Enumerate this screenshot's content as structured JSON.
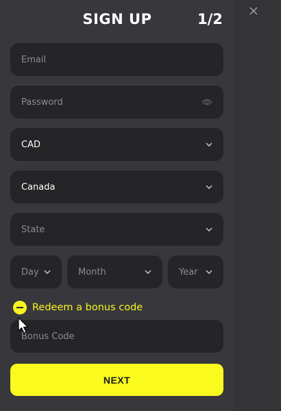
{
  "header": {
    "title": "SIGN UP",
    "step": "1/2"
  },
  "form": {
    "email_placeholder": "Email",
    "password_placeholder": "Password",
    "currency_value": "CAD",
    "country_value": "Canada",
    "state_placeholder": "State",
    "day_placeholder": "Day",
    "month_placeholder": "Month",
    "year_placeholder": "Year",
    "bonus_toggle_label": "Redeem a bonus code",
    "bonus_code_placeholder": "Bonus Code"
  },
  "actions": {
    "next_label": "NEXT",
    "close_icon": "close-icon"
  },
  "colors": {
    "accent": "#fafa1f",
    "field_bg": "#252528",
    "panel_bg": "#38383c"
  }
}
